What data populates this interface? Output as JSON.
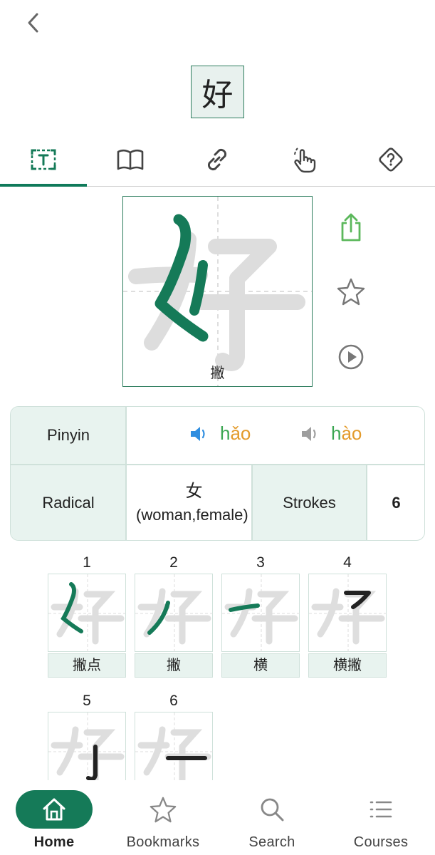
{
  "header": {
    "back_icon": "chevron-left-icon",
    "character": "好"
  },
  "tabs": [
    {
      "name": "text",
      "icon": "text-box-icon",
      "active": true
    },
    {
      "name": "dictionary",
      "icon": "book-icon",
      "active": false
    },
    {
      "name": "links",
      "icon": "link-icon",
      "active": false
    },
    {
      "name": "practice",
      "icon": "tap-hand-icon",
      "active": false
    },
    {
      "name": "quiz",
      "icon": "question-diamond-icon",
      "active": false
    }
  ],
  "stroke_demo": {
    "character": "好",
    "current_stroke_name": "撇"
  },
  "side_actions": {
    "share_icon": "share-icon",
    "bookmark_icon": "star-icon",
    "play_icon": "play-icon"
  },
  "info": {
    "pinyin_label": "Pinyin",
    "pinyin_1": {
      "initial": "h",
      "final": "ǎo"
    },
    "pinyin_2": {
      "initial": "h",
      "final": "ào"
    },
    "radical_label": "Radical",
    "radical_char": "女",
    "radical_meaning": "(woman,female)",
    "strokes_label": "Strokes",
    "strokes_value": "6"
  },
  "strokes": [
    {
      "num": "1",
      "name": "撇点"
    },
    {
      "num": "2",
      "name": "撇"
    },
    {
      "num": "3",
      "name": "横"
    },
    {
      "num": "4",
      "name": "横撇"
    },
    {
      "num": "5",
      "name": ""
    },
    {
      "num": "6",
      "name": ""
    }
  ],
  "nav": [
    {
      "label": "Home",
      "icon": "home-icon",
      "active": true
    },
    {
      "label": "Bookmarks",
      "icon": "star-icon",
      "active": false
    },
    {
      "label": "Search",
      "icon": "search-icon",
      "active": false
    },
    {
      "label": "Courses",
      "icon": "list-icon",
      "active": false
    }
  ],
  "colors": {
    "accent": "#157a58",
    "tone_initial": "#3aa651",
    "tone_final": "#e39b2c",
    "speaker_active": "#2f8ee0",
    "speaker_idle": "#9e9e9e"
  }
}
